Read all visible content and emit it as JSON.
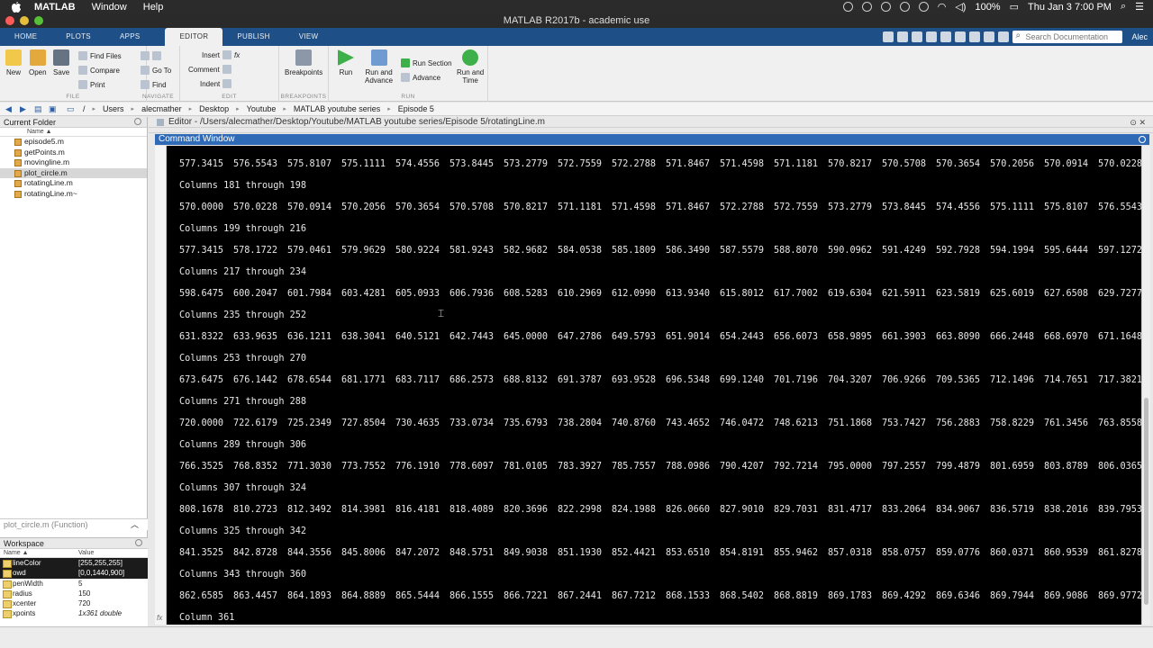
{
  "menubar": {
    "app": "MATLAB",
    "items": [
      "Window",
      "Help"
    ],
    "battery": "100%",
    "clock": "Thu Jan 3  7:00 PM"
  },
  "window": {
    "title": "MATLAB R2017b - academic use"
  },
  "tabs": [
    "HOME",
    "PLOTS",
    "APPS",
    "EDITOR",
    "PUBLISH",
    "VIEW"
  ],
  "active_tab": "EDITOR",
  "search_placeholder": "Search Documentation",
  "user": "Alec",
  "ribbon": {
    "file": {
      "label": "FILE",
      "new": "New",
      "open": "Open",
      "save": "Save",
      "find_files": "Find Files",
      "compare": "Compare",
      "print": "Print"
    },
    "navigate": {
      "label": "NAVIGATE",
      "goto": "Go To",
      "find": "Find"
    },
    "edit": {
      "label": "EDIT",
      "insert": "Insert",
      "comment": "Comment",
      "indent": "Indent"
    },
    "breakpoints": {
      "label": "BREAKPOINTS",
      "breakpoints": "Breakpoints"
    },
    "run": {
      "label": "RUN",
      "run": "Run",
      "run_advance": "Run and\nAdvance",
      "run_section": "Run Section",
      "advance": "Advance",
      "run_time": "Run and\nTime"
    }
  },
  "path": [
    "/",
    "Users",
    "alecmather",
    "Desktop",
    "Youtube",
    "MATLAB youtube series",
    "Episode 5"
  ],
  "current_folder": {
    "title": "Current Folder",
    "col_name": "Name ▲",
    "files": [
      {
        "name": "episode5.m",
        "selected": false
      },
      {
        "name": "getPoints.m",
        "selected": false
      },
      {
        "name": "movingline.m",
        "selected": false
      },
      {
        "name": "plot_circle.m",
        "selected": true
      },
      {
        "name": "rotatingLine.m",
        "selected": false
      },
      {
        "name": "rotatingLine.m~",
        "selected": false
      }
    ],
    "details": "plot_circle.m  (Function)"
  },
  "workspace": {
    "title": "Workspace",
    "col_name": "Name ▲",
    "col_value": "Value",
    "vars": [
      {
        "name": "lineColor",
        "value": "[255,255,255]",
        "dark": true
      },
      {
        "name": "owd",
        "value": "[0,0,1440,900]",
        "dark": true
      },
      {
        "name": "penWidth",
        "value": "5",
        "dark": false
      },
      {
        "name": "radius",
        "value": "150",
        "dark": false
      },
      {
        "name": "xcenter",
        "value": "720",
        "dark": false
      },
      {
        "name": "xpoints",
        "value": "1x361 double",
        "dark": false,
        "italic": true
      }
    ]
  },
  "editor": {
    "title": "Editor - /Users/alecmather/Desktop/Youtube/MATLAB youtube series/Episode 5/rotatingLine.m"
  },
  "command_window": {
    "title": "Command Window",
    "first_row": [
      "577.3415",
      "576.5543",
      "575.8107",
      "575.1111",
      "574.4556",
      "573.8445",
      "573.2779",
      "572.7559",
      "572.2788",
      "571.8467",
      "571.4598",
      "571.1181",
      "570.8217",
      "570.5708",
      "570.3654",
      "570.2056",
      "570.0914",
      "570.0228"
    ],
    "blocks": [
      {
        "header": "Columns 181 through 198",
        "values": [
          "570.0000",
          "570.0228",
          "570.0914",
          "570.2056",
          "570.3654",
          "570.5708",
          "570.8217",
          "571.1181",
          "571.4598",
          "571.8467",
          "572.2788",
          "572.7559",
          "573.2779",
          "573.8445",
          "574.4556",
          "575.1111",
          "575.8107",
          "576.5543"
        ]
      },
      {
        "header": "Columns 199 through 216",
        "values": [
          "577.3415",
          "578.1722",
          "579.0461",
          "579.9629",
          "580.9224",
          "581.9243",
          "582.9682",
          "584.0538",
          "585.1809",
          "586.3490",
          "587.5579",
          "588.8070",
          "590.0962",
          "591.4249",
          "592.7928",
          "594.1994",
          "595.6444",
          "597.1272"
        ]
      },
      {
        "header": "Columns 217 through 234",
        "values": [
          "598.6475",
          "600.2047",
          "601.7984",
          "603.4281",
          "605.0933",
          "606.7936",
          "608.5283",
          "610.2969",
          "612.0990",
          "613.9340",
          "615.8012",
          "617.7002",
          "619.6304",
          "621.5911",
          "623.5819",
          "625.6019",
          "627.6508",
          "629.7277"
        ]
      },
      {
        "header": "Columns 235 through 252",
        "values": [
          "631.8322",
          "633.9635",
          "636.1211",
          "638.3041",
          "640.5121",
          "642.7443",
          "645.0000",
          "647.2786",
          "649.5793",
          "651.9014",
          "654.2443",
          "656.6073",
          "658.9895",
          "661.3903",
          "663.8090",
          "666.2448",
          "668.6970",
          "671.1648"
        ]
      },
      {
        "header": "Columns 253 through 270",
        "values": [
          "673.6475",
          "676.1442",
          "678.6544",
          "681.1771",
          "683.7117",
          "686.2573",
          "688.8132",
          "691.3787",
          "693.9528",
          "696.5348",
          "699.1240",
          "701.7196",
          "704.3207",
          "706.9266",
          "709.5365",
          "712.1496",
          "714.7651",
          "717.3821"
        ]
      },
      {
        "header": "Columns 271 through 288",
        "values": [
          "720.0000",
          "722.6179",
          "725.2349",
          "727.8504",
          "730.4635",
          "733.0734",
          "735.6793",
          "738.2804",
          "740.8760",
          "743.4652",
          "746.0472",
          "748.6213",
          "751.1868",
          "753.7427",
          "756.2883",
          "758.8229",
          "761.3456",
          "763.8558"
        ]
      },
      {
        "header": "Columns 289 through 306",
        "values": [
          "766.3525",
          "768.8352",
          "771.3030",
          "773.7552",
          "776.1910",
          "778.6097",
          "781.0105",
          "783.3927",
          "785.7557",
          "788.0986",
          "790.4207",
          "792.7214",
          "795.0000",
          "797.2557",
          "799.4879",
          "801.6959",
          "803.8789",
          "806.0365"
        ]
      },
      {
        "header": "Columns 307 through 324",
        "values": [
          "808.1678",
          "810.2723",
          "812.3492",
          "814.3981",
          "816.4181",
          "818.4089",
          "820.3696",
          "822.2998",
          "824.1988",
          "826.0660",
          "827.9010",
          "829.7031",
          "831.4717",
          "833.2064",
          "834.9067",
          "836.5719",
          "838.2016",
          "839.7953"
        ]
      },
      {
        "header": "Columns 325 through 342",
        "values": [
          "841.3525",
          "842.8728",
          "844.3556",
          "845.8006",
          "847.2072",
          "848.5751",
          "849.9038",
          "851.1930",
          "852.4421",
          "853.6510",
          "854.8191",
          "855.9462",
          "857.0318",
          "858.0757",
          "859.0776",
          "860.0371",
          "860.9539",
          "861.8278"
        ]
      },
      {
        "header": "Columns 343 through 360",
        "values": [
          "862.6585",
          "863.4457",
          "864.1893",
          "864.8889",
          "865.5444",
          "866.1555",
          "866.7221",
          "867.2441",
          "867.7212",
          "868.1533",
          "868.5402",
          "868.8819",
          "869.1783",
          "869.4292",
          "869.6346",
          "869.7944",
          "869.9086",
          "869.9772"
        ]
      }
    ],
    "last_header": "Column 361",
    "prompt_icon": "fx"
  }
}
